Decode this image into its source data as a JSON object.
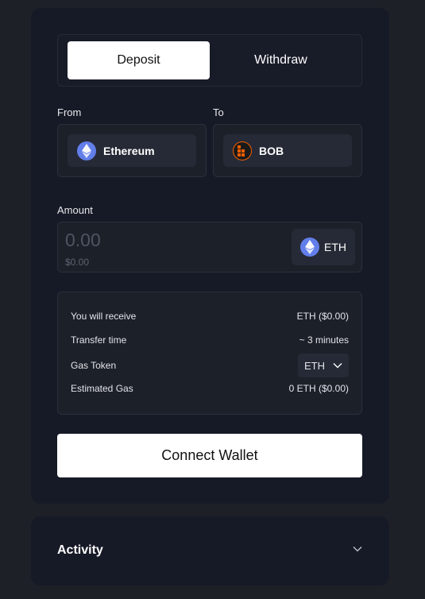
{
  "tabs": {
    "deposit": "Deposit",
    "withdraw": "Withdraw"
  },
  "from": {
    "label": "From",
    "chain": "Ethereum",
    "icon": "ethereum-icon"
  },
  "to": {
    "label": "To",
    "chain": "BOB",
    "icon": "bob-logo-icon"
  },
  "amount": {
    "label": "Amount",
    "value": "0.00",
    "usd": "$0.00",
    "token": "ETH",
    "token_icon": "ethereum-icon"
  },
  "info": {
    "receive_label": "You will receive",
    "receive_value": "ETH ($0.00)",
    "time_label": "Transfer time",
    "time_value": "~ 3 minutes",
    "gas_token_label": "Gas Token",
    "gas_token_value": "ETH",
    "est_gas_label": "Estimated Gas",
    "est_gas_value": "0 ETH ($0.00)"
  },
  "connect_button": "Connect Wallet",
  "activity": {
    "title": "Activity"
  },
  "colors": {
    "page_bg": "#1e2028",
    "card_bg": "#161a26",
    "eth_blue": "#627eea",
    "bob_orange": "#f25d00"
  }
}
